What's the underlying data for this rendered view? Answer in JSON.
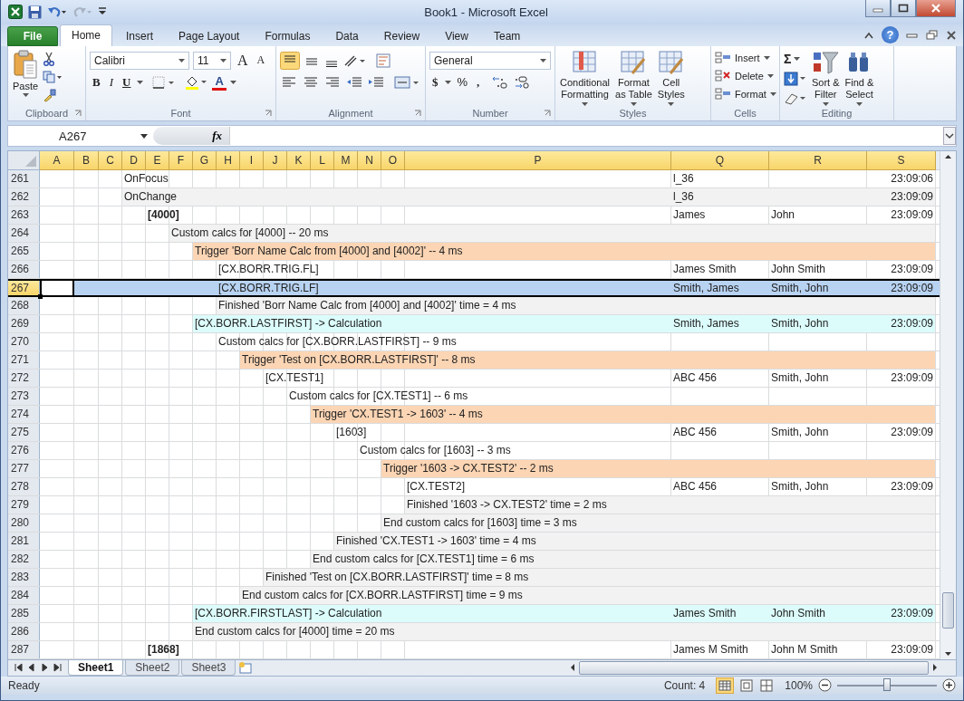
{
  "window": {
    "title": "Book1  -  Microsoft Excel",
    "help": "?"
  },
  "tabs": [
    {
      "label": "File",
      "kind": "file",
      "selected": false
    },
    {
      "label": "Home",
      "kind": "tab",
      "selected": true
    },
    {
      "label": "Insert",
      "kind": "tab",
      "selected": false
    },
    {
      "label": "Page Layout",
      "kind": "tab",
      "selected": false
    },
    {
      "label": "Formulas",
      "kind": "tab",
      "selected": false
    },
    {
      "label": "Data",
      "kind": "tab",
      "selected": false
    },
    {
      "label": "Review",
      "kind": "tab",
      "selected": false
    },
    {
      "label": "View",
      "kind": "tab",
      "selected": false
    },
    {
      "label": "Team",
      "kind": "tab",
      "selected": false
    }
  ],
  "ribbon": {
    "clipboard": {
      "label": "Clipboard",
      "paste": "Paste"
    },
    "font": {
      "label": "Font",
      "name": "Calibri",
      "size": "11",
      "grow": "A",
      "shrink": "A",
      "bold": "B",
      "italic": "I",
      "underline": "U",
      "color_letter": "A"
    },
    "alignment": {
      "label": "Alignment"
    },
    "number": {
      "label": "Number",
      "format": "General",
      "currency": "$",
      "percent": "%",
      "comma": ","
    },
    "styles": {
      "label": "Styles",
      "buttons": [
        {
          "line1": "Conditional",
          "line2": "Formatting"
        },
        {
          "line1": "Format",
          "line2": "as Table"
        },
        {
          "line1": "Cell",
          "line2": "Styles"
        }
      ]
    },
    "cells": {
      "label": "Cells",
      "buttons": [
        "Insert",
        "Delete",
        "Format"
      ]
    },
    "editing": {
      "label": "Editing",
      "sum": "Σ",
      "buttons": [
        {
          "line1": "Sort &",
          "line2": "Filter"
        },
        {
          "line1": "Find &",
          "line2": "Select"
        }
      ]
    }
  },
  "formula_bar": {
    "name_box": "A267",
    "fx": "fx"
  },
  "columns": [
    "A",
    "B",
    "C",
    "D",
    "E",
    "F",
    "G",
    "H",
    "I",
    "J",
    "K",
    "L",
    "M",
    "N",
    "O",
    "P",
    "Q",
    "R",
    "S"
  ],
  "rows": [
    {
      "number": "261",
      "selected": false,
      "bold": false,
      "D": "OnFocus",
      "Q": "l_36",
      "S": "23:09:06"
    },
    {
      "number": "262",
      "selected": false,
      "bold": false,
      "color": "#f2f2f2",
      "D": "OnChange",
      "Q": "l_36",
      "S": "23:09:09"
    },
    {
      "number": "263",
      "selected": false,
      "bold": true,
      "E": "[4000]",
      "Q": "James",
      "R": "John",
      "S": "23:09:09"
    },
    {
      "number": "264",
      "selected": false,
      "bold": false,
      "color": "#f2f2f2",
      "F": "Custom calcs for [4000] -- 20 ms"
    },
    {
      "number": "265",
      "selected": false,
      "bold": false,
      "color": "#fcd5b4",
      "G": "Trigger 'Borr Name Calc from [4000] and [4002]' -- 4 ms"
    },
    {
      "number": "266",
      "selected": false,
      "bold": false,
      "H": "[CX.BORR.TRIG.FL]",
      "Q": "James Smith",
      "R": "John Smith",
      "S": "23:09:09"
    },
    {
      "number": "267",
      "selected": true,
      "bold": false,
      "H": "[CX.BORR.TRIG.LF]",
      "Q": "Smith, James",
      "R": "Smith, John",
      "S": "23:09:09"
    },
    {
      "number": "268",
      "selected": false,
      "bold": false,
      "color": "#f2f2f2",
      "H": "Finished 'Borr Name Calc from [4000] and [4002]' time = 4 ms"
    },
    {
      "number": "269",
      "selected": false,
      "bold": false,
      "color": "#dcfcfc",
      "G": "[CX.BORR.LASTFIRST] -> Calculation",
      "Q": "Smith, James",
      "R": "Smith, John",
      "S": "23:09:09"
    },
    {
      "number": "270",
      "selected": false,
      "bold": false,
      "H": "Custom calcs for [CX.BORR.LASTFIRST] -- 9 ms"
    },
    {
      "number": "271",
      "selected": false,
      "bold": false,
      "color": "#fcd5b4",
      "I": "Trigger 'Test on [CX.BORR.LASTFIRST]' -- 8 ms"
    },
    {
      "number": "272",
      "selected": false,
      "bold": false,
      "J": "[CX.TEST1]",
      "Q": "ABC 456",
      "R": "Smith, John",
      "S": "23:09:09"
    },
    {
      "number": "273",
      "selected": false,
      "bold": false,
      "K": "Custom calcs for [CX.TEST1] -- 6 ms"
    },
    {
      "number": "274",
      "selected": false,
      "bold": false,
      "color": "#fcd5b4",
      "L": "Trigger 'CX.TEST1 -> 1603' -- 4 ms"
    },
    {
      "number": "275",
      "selected": false,
      "bold": false,
      "M": "[1603]",
      "Q": "ABC 456",
      "R": "Smith, John",
      "S": "23:09:09"
    },
    {
      "number": "276",
      "selected": false,
      "bold": false,
      "N": "Custom calcs for [1603] -- 3 ms"
    },
    {
      "number": "277",
      "selected": false,
      "bold": false,
      "color": "#fcd5b4",
      "O": "Trigger '1603 -> CX.TEST2' -- 2 ms"
    },
    {
      "number": "278",
      "selected": false,
      "bold": false,
      "P": "[CX.TEST2]",
      "Q": "ABC 456",
      "R": "Smith, John",
      "S": "23:09:09"
    },
    {
      "number": "279",
      "selected": false,
      "bold": false,
      "color": "#f2f2f2",
      "P": "Finished '1603 -> CX.TEST2' time = 2 ms"
    },
    {
      "number": "280",
      "selected": false,
      "bold": false,
      "color": "#f2f2f2",
      "O": "End custom calcs for [1603] time = 3 ms"
    },
    {
      "number": "281",
      "selected": false,
      "bold": false,
      "color": "#f2f2f2",
      "M": "Finished 'CX.TEST1 -> 1603' time = 4 ms"
    },
    {
      "number": "282",
      "selected": false,
      "bold": false,
      "color": "#f2f2f2",
      "L": "End custom calcs for [CX.TEST1] time = 6 ms"
    },
    {
      "number": "283",
      "selected": false,
      "bold": false,
      "color": "#f2f2f2",
      "J": "Finished 'Test on [CX.BORR.LASTFIRST]' time = 8 ms"
    },
    {
      "number": "284",
      "selected": false,
      "bold": false,
      "color": "#f2f2f2",
      "I": "End custom calcs for [CX.BORR.LASTFIRST] time = 9 ms"
    },
    {
      "number": "285",
      "selected": false,
      "bold": false,
      "color": "#dcfcfc",
      "G": "[CX.BORR.FIRSTLAST] -> Calculation",
      "Q": "James Smith",
      "R": "John Smith",
      "S": "23:09:09"
    },
    {
      "number": "286",
      "selected": false,
      "bold": false,
      "color": "#f2f2f2",
      "G": "End custom calcs for [4000] time = 20 ms"
    },
    {
      "number": "287",
      "selected": false,
      "bold": true,
      "E": "[1868]",
      "Q": "James M Smith",
      "R": "John M Smith",
      "S": "23:09:09"
    }
  ],
  "sheet_tabs": [
    {
      "label": "Sheet1",
      "selected": true
    },
    {
      "label": "Sheet2",
      "selected": false
    },
    {
      "label": "Sheet3",
      "selected": false
    }
  ],
  "status_bar": {
    "ready": "Ready",
    "count": "Count: 4",
    "zoom": "100%",
    "zoom_slider": {
      "level": 0.5
    }
  }
}
